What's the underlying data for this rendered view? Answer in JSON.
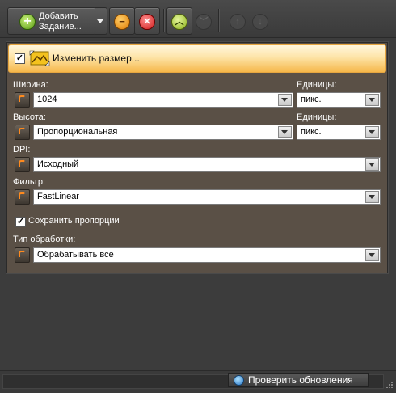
{
  "toolbar": {
    "add_task_label_line1": "Добавить",
    "add_task_label_line2": "Задание...",
    "icons": {
      "add": "plus-circle-icon",
      "remove": "minus-circle-icon",
      "delete": "x-circle-icon",
      "move_up": "chevron-up-circle-icon",
      "move_down": "chevron-down-circle-icon",
      "arrow_up": "arrow-up-circle-icon",
      "arrow_down": "arrow-down-circle-icon"
    },
    "colors": {
      "add": "#6aa61c",
      "remove": "#e07a00",
      "delete": "#d01a1a",
      "move_up": "#8db21c"
    }
  },
  "panel": {
    "enabled": true,
    "title": "Изменить размер...",
    "header_gradient": [
      "#fff6dc",
      "#f6b74a"
    ],
    "fields": {
      "width": {
        "label": "Ширина:",
        "value": "1024",
        "units_label": "Единицы:",
        "units_value": "пикс."
      },
      "height": {
        "label": "Высота:",
        "value": "Пропорциональная",
        "units_label": "Единицы:",
        "units_value": "пикс."
      },
      "dpi": {
        "label": "DPI:",
        "value": "Исходный"
      },
      "filter": {
        "label": "Фильтр:",
        "value": "FastLinear"
      },
      "keep_proportions": {
        "label": "Сохранить пропорции",
        "checked": true
      },
      "processing": {
        "label": "Тип обработки:",
        "value": "Обрабатывать все"
      }
    }
  },
  "status": {
    "check_updates": "Проверить обновления"
  }
}
